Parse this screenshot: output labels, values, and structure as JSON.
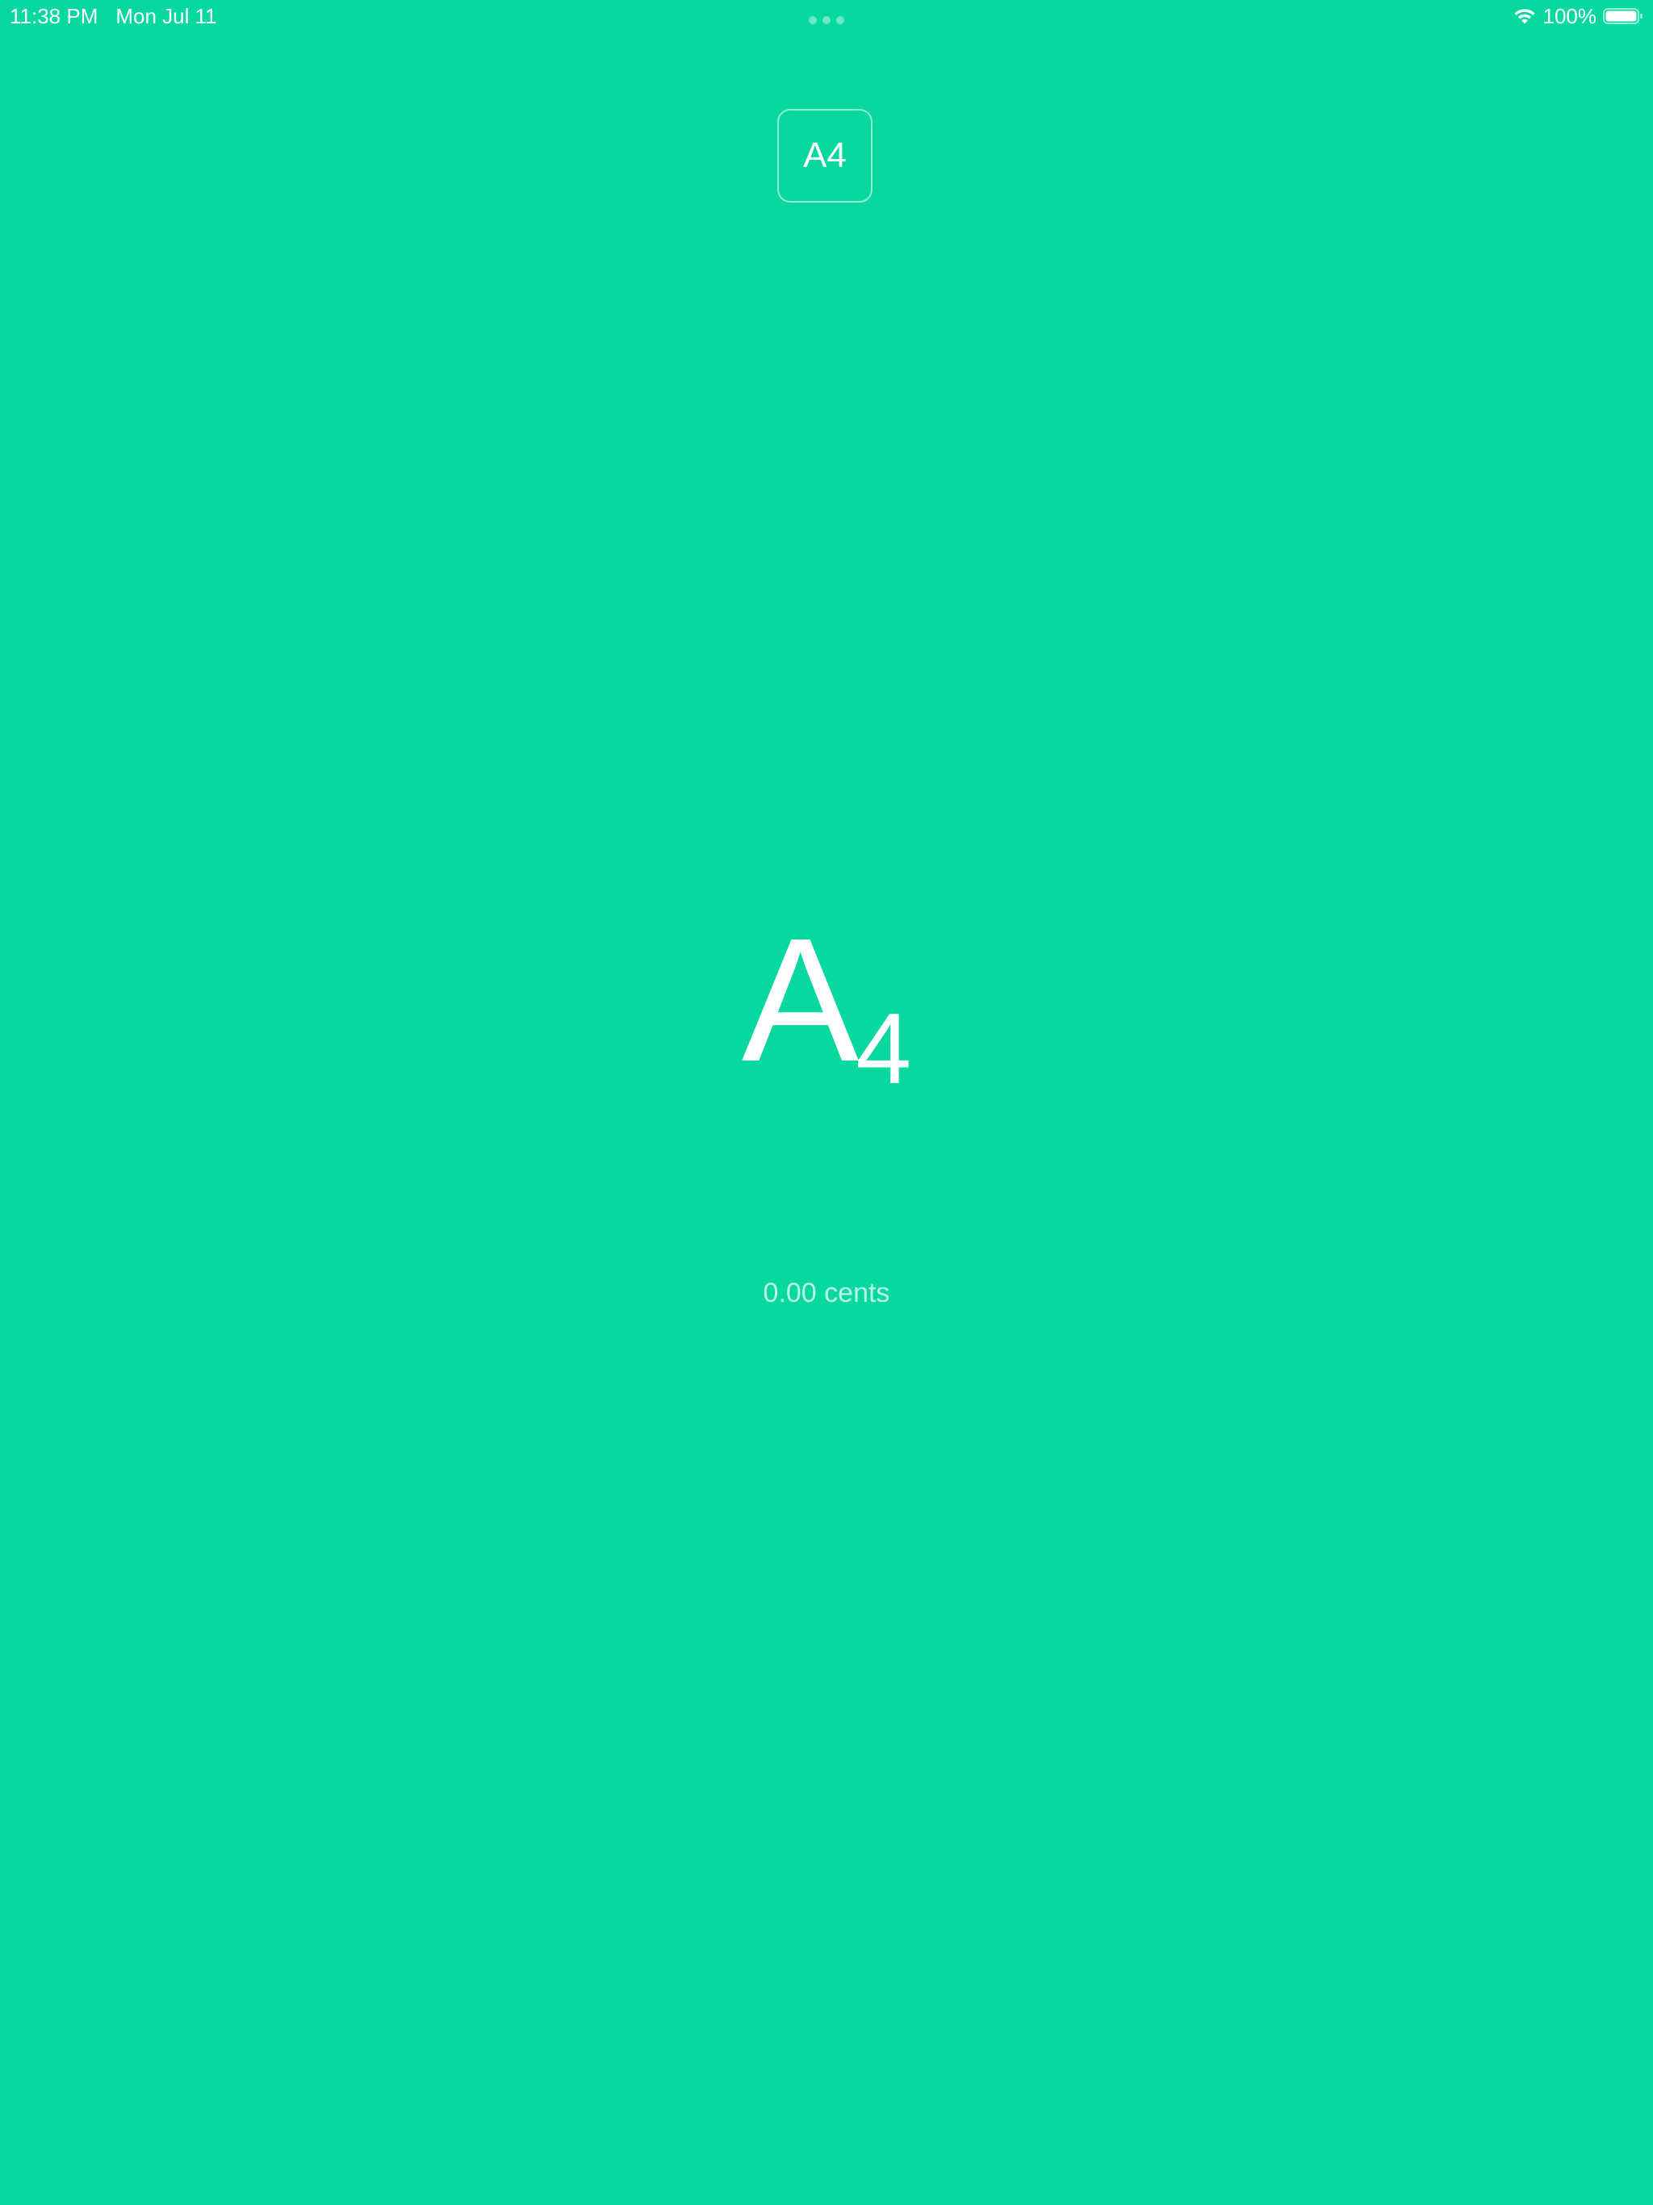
{
  "status_bar": {
    "time": "11:38 PM",
    "date": "Mon Jul 11",
    "battery_percent": "100%",
    "battery_level": 1.0,
    "icons": [
      "wifi-icon",
      "battery-icon"
    ]
  },
  "note_selector": {
    "label": "A4"
  },
  "tuner": {
    "note_letter": "A",
    "note_octave": "4",
    "cents_text": "0.00 cents"
  },
  "colors": {
    "background": "#06D8A0",
    "foreground": "#FFFFFF"
  }
}
